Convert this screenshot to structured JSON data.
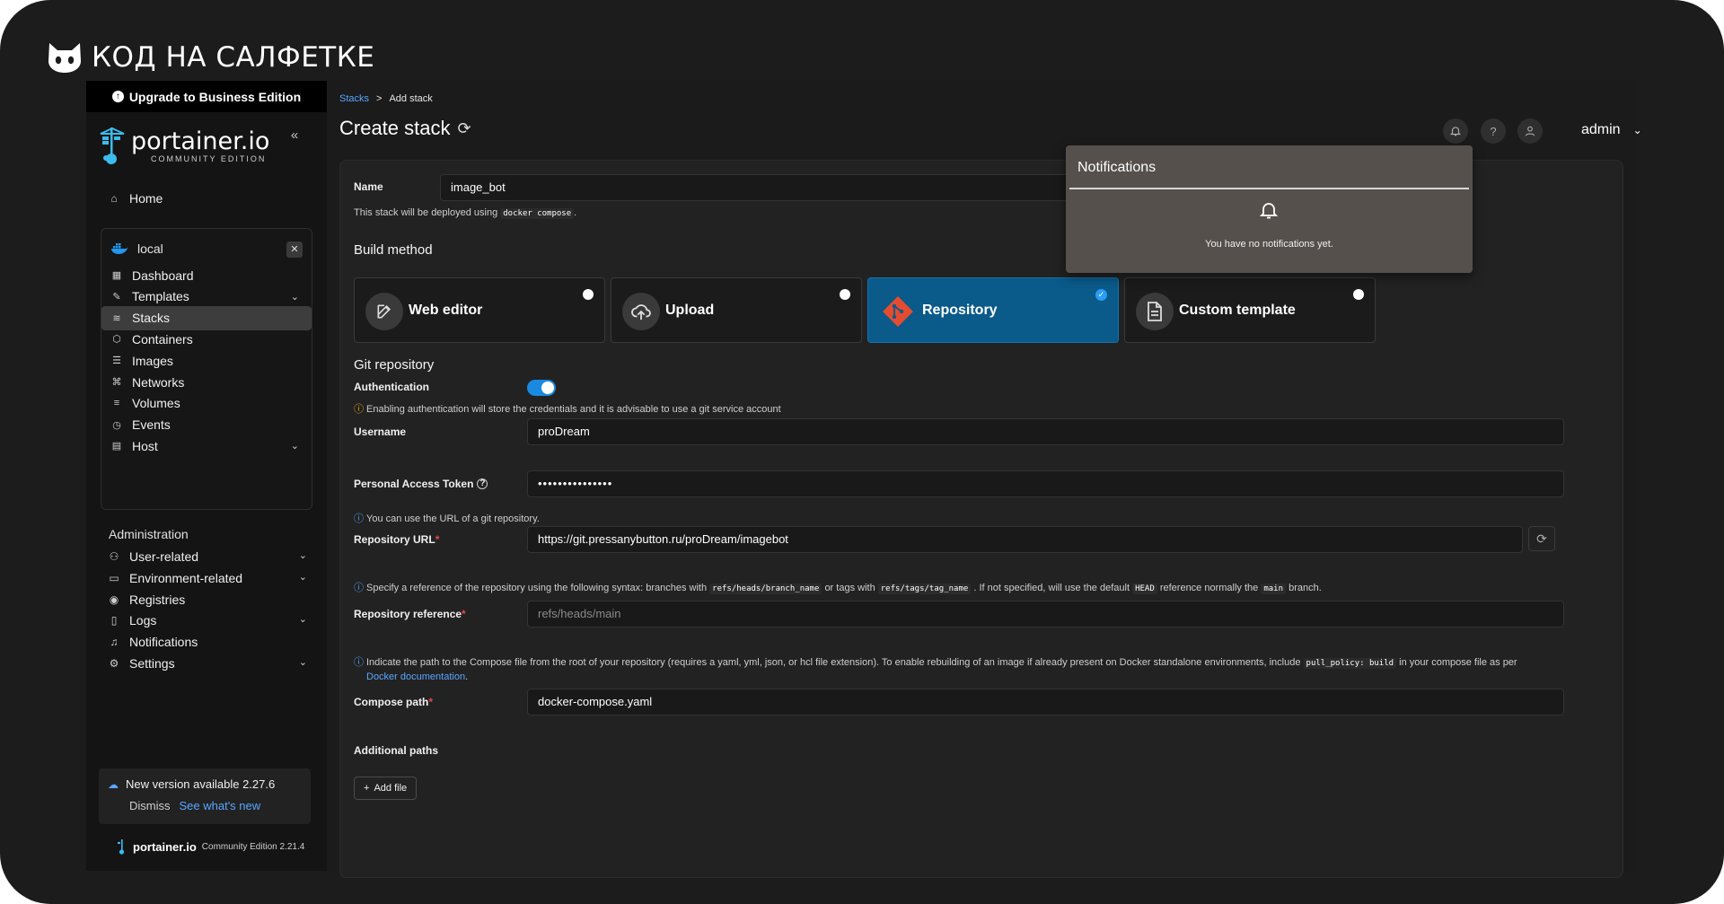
{
  "brand": {
    "text": "КОД НА САЛФЕТКЕ"
  },
  "sidebar": {
    "upgrade_label": "Upgrade to Business Edition",
    "logo_name": "portainer.io",
    "logo_edition": "COMMUNITY EDITION",
    "home_label": "Home",
    "environment": {
      "name": "local",
      "items": [
        {
          "label": "Dashboard",
          "icon": "dashboard-icon",
          "has_chevron": false
        },
        {
          "label": "Templates",
          "icon": "edit-icon",
          "has_chevron": true
        },
        {
          "label": "Stacks",
          "icon": "stack-icon",
          "has_chevron": false,
          "active": true
        },
        {
          "label": "Containers",
          "icon": "cube-icon",
          "has_chevron": false
        },
        {
          "label": "Images",
          "icon": "list-icon",
          "has_chevron": false
        },
        {
          "label": "Networks",
          "icon": "network-icon",
          "has_chevron": false
        },
        {
          "label": "Volumes",
          "icon": "database-icon",
          "has_chevron": false
        },
        {
          "label": "Events",
          "icon": "clock-icon",
          "has_chevron": false
        },
        {
          "label": "Host",
          "icon": "server-icon",
          "has_chevron": true
        }
      ]
    },
    "admin_title": "Administration",
    "admin_items": [
      {
        "label": "User-related",
        "icon": "users-icon",
        "has_chevron": true
      },
      {
        "label": "Environment-related",
        "icon": "hdd-icon",
        "has_chevron": true
      },
      {
        "label": "Registries",
        "icon": "radio-icon",
        "has_chevron": false
      },
      {
        "label": "Logs",
        "icon": "file-icon",
        "has_chevron": true
      },
      {
        "label": "Notifications",
        "icon": "bell-icon",
        "has_chevron": false
      },
      {
        "label": "Settings",
        "icon": "gear-icon",
        "has_chevron": true
      }
    ],
    "update": {
      "message": "New version available 2.27.6",
      "dismiss": "Dismiss",
      "whats_new": "See what's new"
    },
    "footer": {
      "name": "portainer.io",
      "version": "Community Edition 2.21.4"
    }
  },
  "main": {
    "breadcrumb": {
      "parent": "Stacks",
      "separator": ">",
      "current": "Add stack"
    },
    "title": "Create stack",
    "user": "admin",
    "form": {
      "name_label": "Name",
      "name_value": "image_bot",
      "deploy_hint_pre": "This stack will be deployed using",
      "deploy_hint_code": "docker compose",
      "deploy_hint_post": ".",
      "build_method_title": "Build method",
      "build_methods": [
        {
          "label": "Web editor",
          "icon": "edit-icon",
          "selected": false
        },
        {
          "label": "Upload",
          "icon": "upload-cloud-icon",
          "selected": false
        },
        {
          "label": "Repository",
          "icon": "git-icon",
          "selected": true
        },
        {
          "label": "Custom template",
          "icon": "file-text-icon",
          "selected": false
        }
      ],
      "git_title": "Git repository",
      "auth_label": "Authentication",
      "auth_enabled": true,
      "auth_warning": "Enabling authentication will store the credentials and it is advisable to use a git service account",
      "username_label": "Username",
      "username_value": "proDream",
      "token_label": "Personal Access Token",
      "token_value": "•••••••••••••••",
      "url_hint": "You can use the URL of a git repository.",
      "url_label": "Repository URL",
      "url_value": "https://git.pressanybutton.ru/proDream/imagebot",
      "ref_hint_1": "Specify a reference of the repository using the following syntax: branches with",
      "ref_hint_code_1": "refs/heads/branch_name",
      "ref_hint_2": "or tags with",
      "ref_hint_code_2": "refs/tags/tag_name",
      "ref_hint_3": ". If not specified, will use the default",
      "ref_hint_code_3": "HEAD",
      "ref_hint_4": "reference normally the",
      "ref_hint_code_4": "main",
      "ref_hint_5": "branch.",
      "ref_label": "Repository reference",
      "ref_placeholder": "refs/heads/main",
      "compose_hint_1": "Indicate the path to the Compose file from the root of your repository (requires a yaml, yml, json, or hcl file extension).  To enable rebuilding of an image if already present on Docker standalone environments, include",
      "compose_hint_code": "pull_policy: build",
      "compose_hint_2": "in your compose file as per",
      "compose_hint_link": "Docker documentation",
      "compose_hint_3": ".",
      "compose_label": "Compose path",
      "compose_value": "docker-compose.yaml",
      "additional_paths_label": "Additional paths",
      "add_file_label": "Add file"
    }
  },
  "notifications": {
    "title": "Notifications",
    "empty": "You have no notifications yet."
  },
  "colors": {
    "accent": "#1473b0",
    "link": "#58a6ff",
    "git": "#e44c30"
  }
}
